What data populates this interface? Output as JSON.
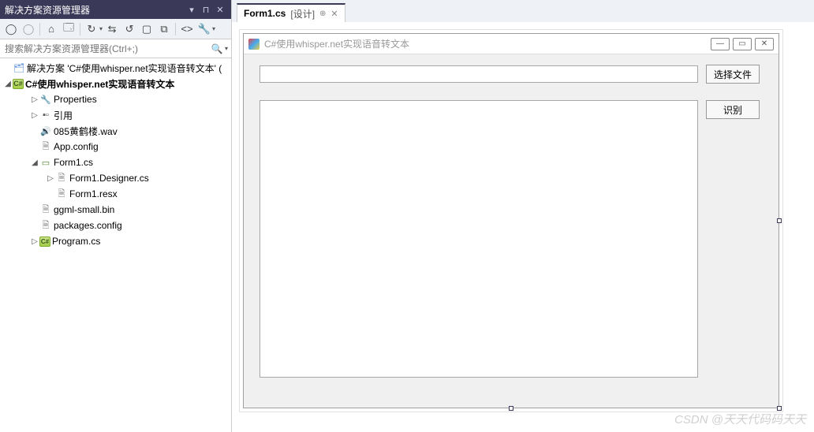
{
  "solutionExplorer": {
    "title": "解决方案资源管理器",
    "searchPlaceholder": "搜索解决方案资源管理器(Ctrl+;)",
    "solutionLabel": "解决方案 'C#使用whisper.net实现语音转文本' (",
    "items": {
      "project": "C#使用whisper.net实现语音转文本",
      "properties": "Properties",
      "references": "引用",
      "wav": "085黄鹤楼.wav",
      "appconfig": "App.config",
      "form1": "Form1.cs",
      "form1designer": "Form1.Designer.cs",
      "form1resx": "Form1.resx",
      "ggml": "ggml-small.bin",
      "packages": "packages.config",
      "program": "Program.cs"
    }
  },
  "tab": {
    "file": "Form1.cs",
    "mode": "[设计]"
  },
  "form": {
    "title": "C#使用whisper.net实现语音转文本",
    "btnSelect": "选择文件",
    "btnRecognize": "识别"
  },
  "watermark": "CSDN @天天代码码天天"
}
